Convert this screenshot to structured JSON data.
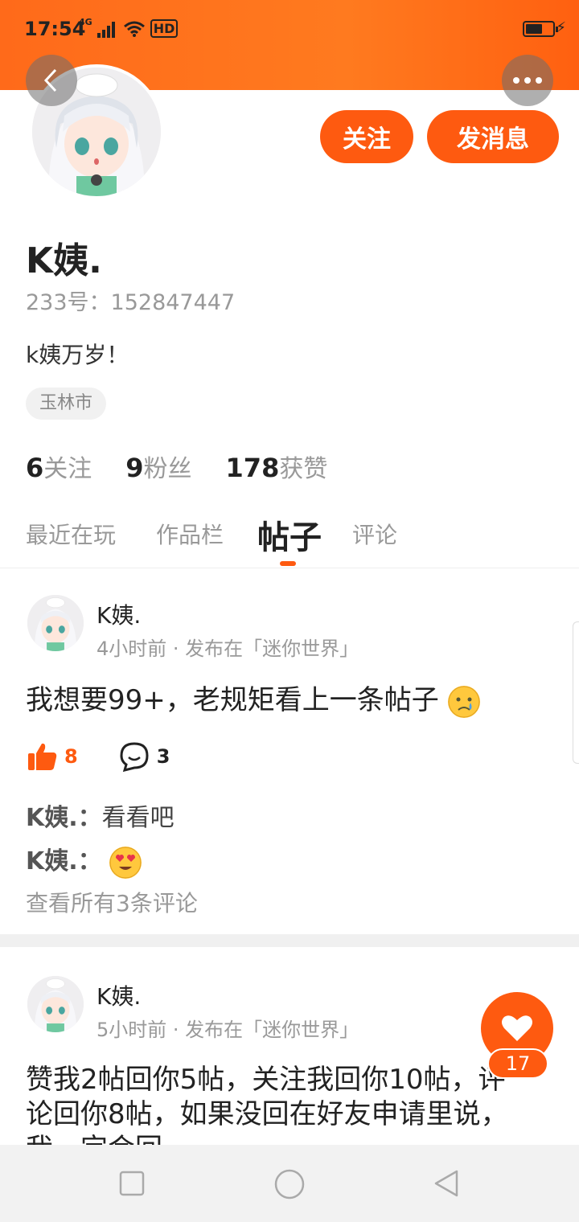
{
  "status_bar": {
    "time": "17:54",
    "network": "4G",
    "hd": "HD"
  },
  "header": {
    "back_icon": "chevron-left-icon",
    "more_icon": "ellipsis-icon"
  },
  "profile": {
    "follow_label": "关注",
    "message_label": "发消息",
    "name": "K姨.",
    "id_text": "233号：152847447",
    "bio": "k姨万岁！",
    "location": "玉林市",
    "stats": [
      {
        "value": "6",
        "label": "关注"
      },
      {
        "value": "9",
        "label": "粉丝"
      },
      {
        "value": "178",
        "label": "获赞"
      }
    ]
  },
  "tabs": [
    {
      "label": "最近在玩"
    },
    {
      "label": "作品栏"
    },
    {
      "label": "帖子",
      "active": true
    },
    {
      "label": "评论"
    }
  ],
  "posts": [
    {
      "author": "K姨.",
      "meta": "4小时前 · 发布在「迷你世界」",
      "text": "我想要99+，老规矩看上一条帖子",
      "likes": "8",
      "comments": "3",
      "comment_list": [
        {
          "author": "K姨.：",
          "text": "看看吧"
        },
        {
          "author": "K姨.：",
          "text": ""
        }
      ],
      "view_all": "查看所有3条评论"
    },
    {
      "author": "K姨.",
      "meta": "5小时前 · 发布在「迷你世界」",
      "text_line1": "赞我2帖回你5帖，关注我回你10帖，评",
      "text_line2": "论回你8帖，如果没回在好友申请里说，",
      "text_line3": "我一定会回"
    }
  ],
  "fab": {
    "count": "17"
  },
  "colors": {
    "accent": "#fe5a10",
    "header_start": "#ff6a1a"
  }
}
